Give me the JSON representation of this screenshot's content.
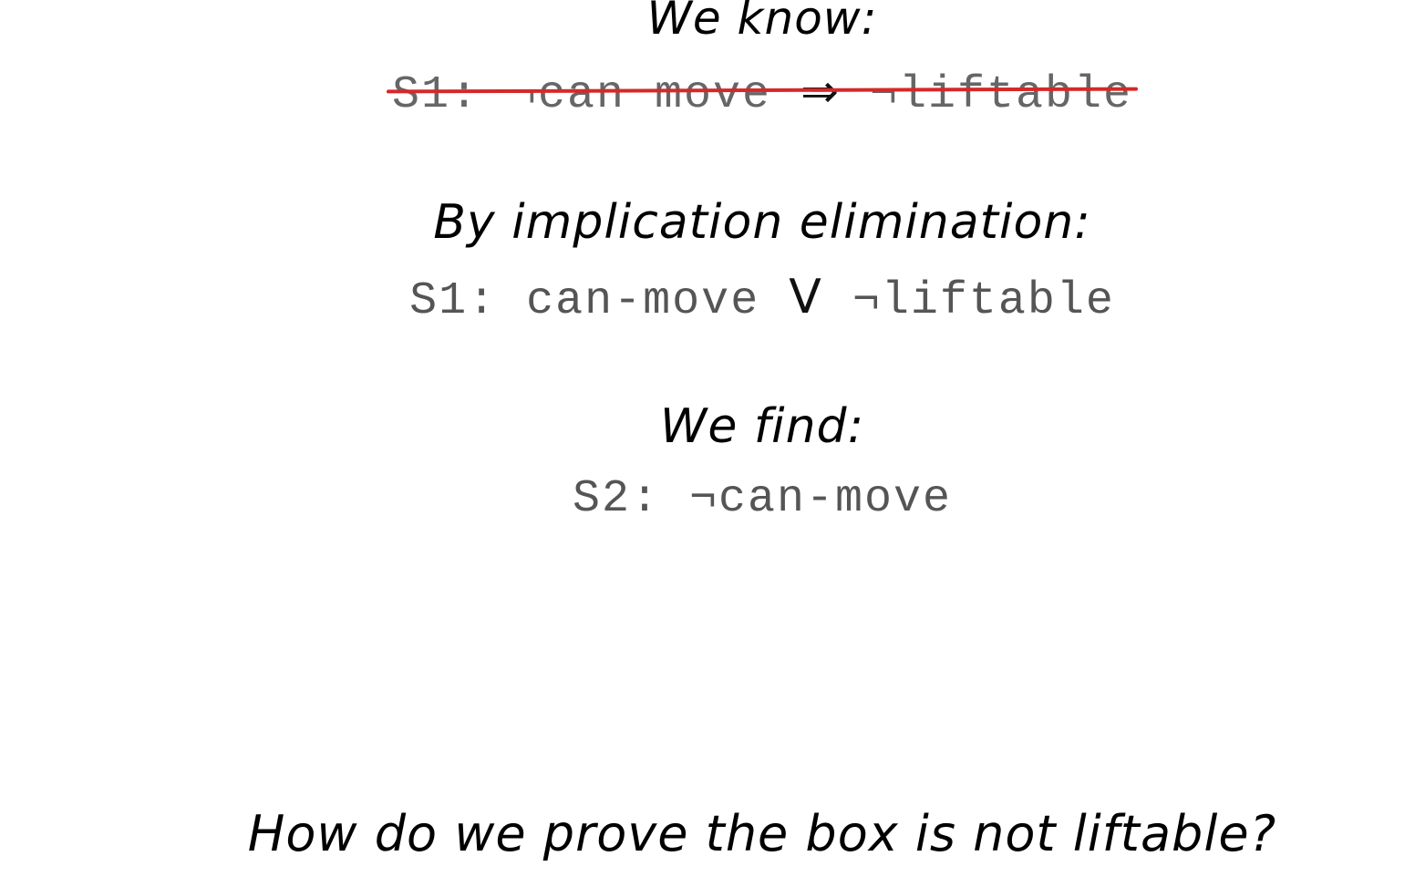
{
  "slide": {
    "we_know": "We know:",
    "s1_implication": {
      "label": "S1:",
      "antecedent": "¬can move",
      "operator": "⇒",
      "consequent": "¬liftable",
      "struck_through": true,
      "strike_color": "#d62828"
    },
    "by_implication": "By implication elimination:",
    "s1_disjunction": {
      "label": "S1:",
      "left": "can-move",
      "operator": "V",
      "right": "¬liftable"
    },
    "we_find": "We find:",
    "s2": {
      "label": "S2:",
      "value": "¬can-move"
    },
    "question": "How do we prove the box is not liftable?"
  }
}
